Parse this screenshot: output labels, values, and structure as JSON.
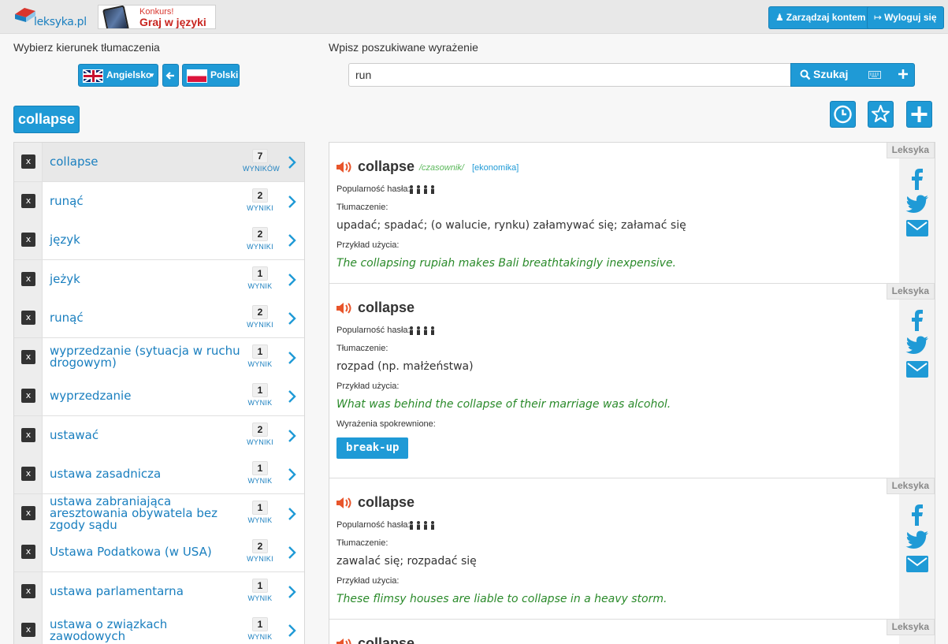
{
  "topbar": {
    "logo_text": "leksyka.pl",
    "banner": {
      "line1": "Konkurs!",
      "line2": "Graj w języki"
    },
    "manage_account": "Zarządzaj kontem",
    "logout": "Wyloguj się"
  },
  "direction": {
    "label": "Wybierz kierunek tłumaczenia",
    "source_lang": "Angielsko",
    "target_lang": "Polski"
  },
  "search": {
    "label": "Wpisz poszukiwane wyrażenie",
    "value": "run",
    "button": "Szukaj"
  },
  "current_term": "collapse",
  "history": [
    {
      "word": "collapse",
      "count": "7",
      "unit": "WYNIKÓW",
      "active": true
    },
    {
      "word": "runąć",
      "count": "2",
      "unit": "WYNIKI"
    },
    {
      "word": "język",
      "count": "2",
      "unit": "WYNIKI"
    },
    {
      "word": "jeżyk",
      "count": "1",
      "unit": "WYNIK"
    },
    {
      "word": "runąć",
      "count": "2",
      "unit": "WYNIKI"
    },
    {
      "word": "wyprzedzanie (sytuacja w ruchu drogowym)",
      "count": "1",
      "unit": "WYNIK"
    },
    {
      "word": "wyprzedzanie",
      "count": "1",
      "unit": "WYNIK"
    },
    {
      "word": "ustawać",
      "count": "2",
      "unit": "WYNIKI"
    },
    {
      "word": "ustawa zasadnicza",
      "count": "1",
      "unit": "WYNIK"
    },
    {
      "word": "ustawa zabraniająca aresztowania obywatela bez zgody sądu",
      "count": "1",
      "unit": "WYNIK"
    },
    {
      "word": "Ustawa Podatkowa (w USA)",
      "count": "2",
      "unit": "WYNIKI"
    },
    {
      "word": "ustawa parlamentarna",
      "count": "1",
      "unit": "WYNIK"
    },
    {
      "word": "ustawa o związkach zawodowych",
      "count": "1",
      "unit": "WYNIK"
    }
  ],
  "remove_label": "x",
  "entries": [
    {
      "source": "Leksyka",
      "headword": "collapse",
      "pos": "/czasownik/",
      "domain": "[ekonomika]",
      "popularity_label": "Popularność hasła:",
      "translation_label": "Tłumaczenie:",
      "translation": "upadać; spadać; (o walucie, rynku) załamywać się; załamać się",
      "example_label": "Przykład użycia:",
      "example": "The collapsing rupiah makes Bali breathtakingly inexpensive."
    },
    {
      "source": "Leksyka",
      "headword": "collapse",
      "popularity_label": "Popularność hasła:",
      "translation_label": "Tłumaczenie:",
      "translation": "rozpad (np. małżeństwa)",
      "example_label": "Przykład użycia:",
      "example": "What was behind the collapse of their marriage was alcohol.",
      "related_label": "Wyrażenia spokrewnione:",
      "related": "break-up"
    },
    {
      "source": "Leksyka",
      "headword": "collapse",
      "popularity_label": "Popularność hasła:",
      "translation_label": "Tłumaczenie:",
      "translation": "zawalać się; rozpadać się",
      "example_label": "Przykład użycia:",
      "example": "These flimsy houses are liable to collapse in a heavy storm."
    },
    {
      "source": "Leksyka",
      "headword": "collapse"
    }
  ],
  "colors": {
    "accent": "#1f9ad6",
    "link": "#1a7fbf",
    "example": "#2a8a2a",
    "speaker": "#e8552b"
  }
}
